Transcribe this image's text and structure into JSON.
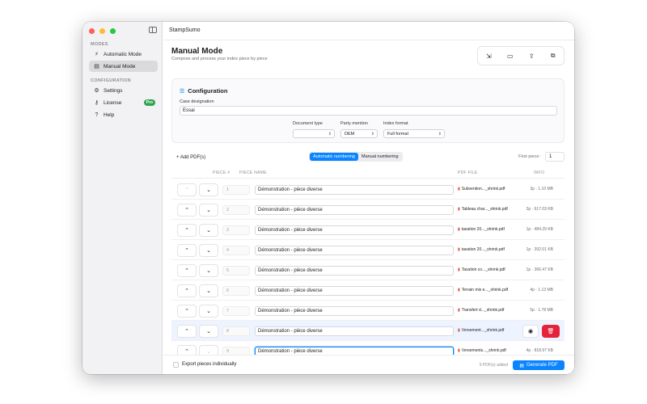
{
  "app": {
    "name": "StampSumo"
  },
  "sidebar": {
    "modes_label": "MODES",
    "config_label": "CONFIGURATION",
    "items": [
      {
        "label": "Automatic Mode",
        "icon": "bolt-icon"
      },
      {
        "label": "Manual Mode",
        "icon": "document-icon"
      },
      {
        "label": "Settings",
        "icon": "gear-icon"
      },
      {
        "label": "License",
        "icon": "key-icon",
        "badge": "Pro"
      },
      {
        "label": "Help",
        "icon": "help-icon"
      }
    ]
  },
  "header": {
    "title": "Manual Mode",
    "subtitle": "Compose and process your index piece by piece"
  },
  "configuration": {
    "title": "Configuration",
    "case_label": "Case designation",
    "case_value": "Essai",
    "doc_type_label": "Document type",
    "doc_type_value": "",
    "party_label": "Party mention",
    "party_value": "DEM",
    "index_label": "Index format",
    "index_value": "Full format"
  },
  "controls": {
    "add_pdf": "+ Add PDF(s)",
    "auto_numbering": "Automatic numbering",
    "manual_numbering": "Manual numbering",
    "first_piece_label": "First piece:",
    "first_piece_value": "1"
  },
  "table": {
    "headers": {
      "piece": "PIECE #",
      "name": "PIECE NAME",
      "file": "PDF FILE",
      "info": "INFO"
    },
    "rows": [
      {
        "num": "1",
        "name": "Démonstration - pièce diverse",
        "file": "Subvention..._shrink.pdf",
        "info": "3p · 1.10 MB"
      },
      {
        "num": "2",
        "name": "Démonstration - pièce diverse",
        "file": "Tableau char..._shrink.pdf",
        "info": "2p · 617.03 KB"
      },
      {
        "num": "3",
        "name": "Démonstration - pièce diverse",
        "file": "taxation 20..._shrink.pdf",
        "info": "1p · 484.29 KB"
      },
      {
        "num": "4",
        "name": "Démonstration - pièce diverse",
        "file": "taxation 20..._shrink.pdf",
        "info": "1p · 392.01 KB"
      },
      {
        "num": "5",
        "name": "Démonstration - pièce diverse",
        "file": "Taxation co..._shrink.pdf",
        "info": "1p · 366.47 KB"
      },
      {
        "num": "6",
        "name": "Démonstration - pièce diverse",
        "file": "Terrain mis e..._shrink.pdf",
        "info": "4p · 1.13 MB"
      },
      {
        "num": "7",
        "name": "Démonstration - pièce diverse",
        "file": "Transfert d..._shrink.pdf",
        "info": "5p · 1.78 MB"
      },
      {
        "num": "8",
        "name": "Démonstration - pièce diverse",
        "file": "Versement..._shrink.pdf",
        "info": ""
      },
      {
        "num": "9",
        "name": "Démonstration - pièce diverse",
        "file": "Versements..._shrink.pdf",
        "info": "4p · 818.97 KB"
      }
    ]
  },
  "footer": {
    "export_label": "Export pieces individually",
    "count": "9 PDF(s) added",
    "generate": "Generate PDF"
  }
}
